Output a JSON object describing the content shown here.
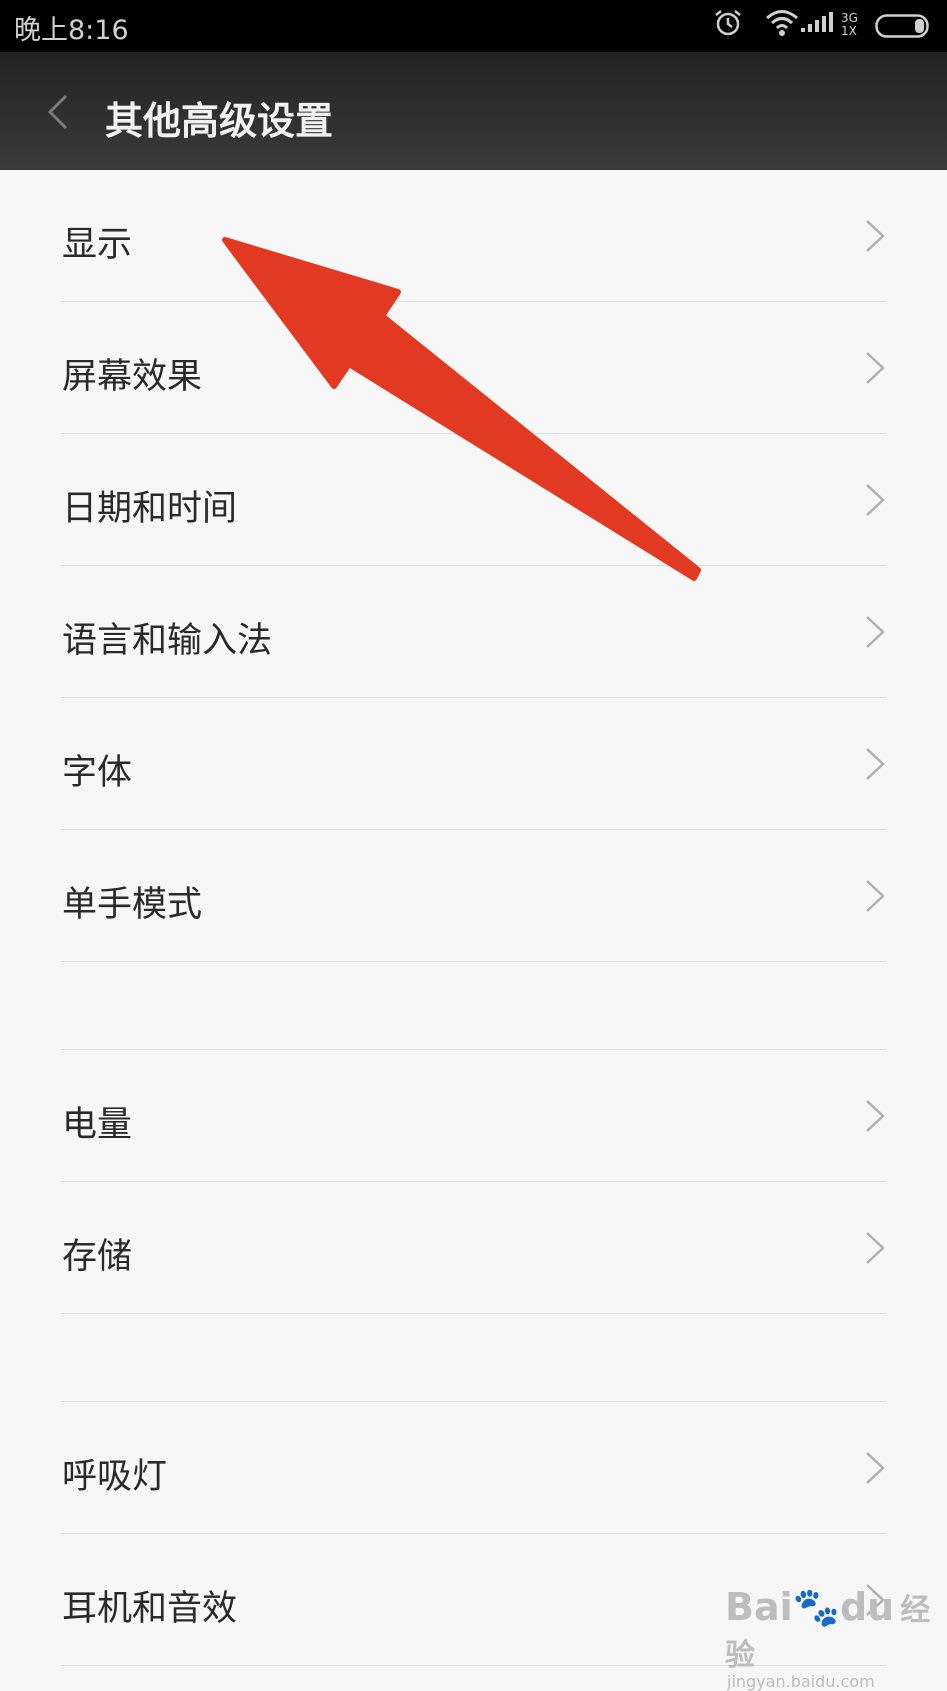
{
  "status": {
    "time": "晚上8:16",
    "network_top": "3G",
    "network_bottom": "1X",
    "icons": [
      "alarm-icon",
      "wifi-icon",
      "signal-icon",
      "battery-icon"
    ]
  },
  "app_bar": {
    "title": "其他高级设置",
    "back_icon": "chevron-left-icon"
  },
  "groups": [
    {
      "items": [
        "显示",
        "屏幕效果",
        "日期和时间",
        "语言和输入法",
        "字体",
        "单手模式"
      ]
    },
    {
      "items": [
        "电量",
        "存储"
      ]
    },
    {
      "items": [
        "呼吸灯",
        "耳机和音效"
      ]
    }
  ],
  "annotation": {
    "arrow_color": "#e23a22"
  },
  "watermark": {
    "brand_a": "Bai",
    "brand_b": "du",
    "suffix": "经验",
    "url": "jingyan.baidu.com"
  }
}
